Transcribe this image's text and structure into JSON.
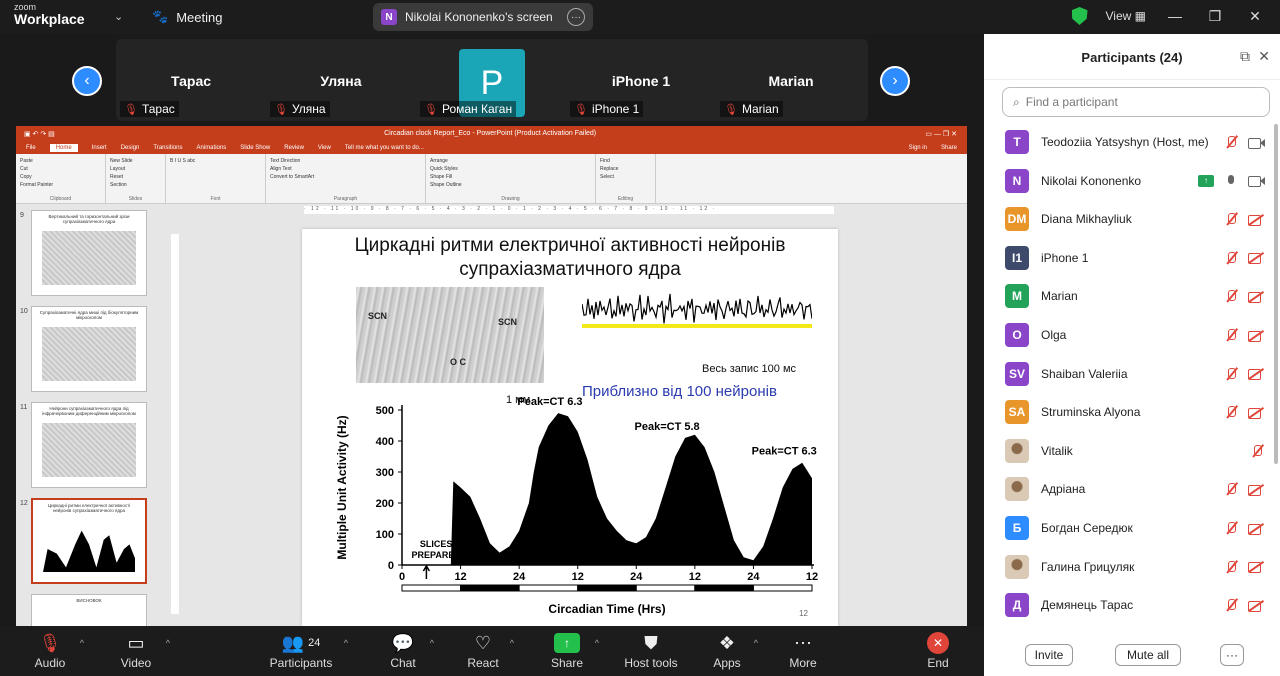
{
  "titlebar": {
    "logo_line1": "zoom",
    "logo_line2": "Workplace",
    "meeting_label": "Meeting",
    "screen_badge": "N",
    "screen_label": "Nikolai Kononenko's screen",
    "view_label": "View"
  },
  "strip": {
    "tiles": [
      {
        "name": "Тарас",
        "label": "Тарас"
      },
      {
        "name": "Уляна",
        "label": "Уляна"
      },
      {
        "name": "P",
        "label": "Роман Каган"
      },
      {
        "name": "iPhone 1",
        "label": "iPhone 1"
      },
      {
        "name": "Marian",
        "label": "Marian"
      }
    ]
  },
  "powerpoint": {
    "window_title": "Circadian clock Report_Eco - PowerPoint (Product Activation Failed)",
    "tabs": [
      "File",
      "Home",
      "Insert",
      "Design",
      "Transitions",
      "Animations",
      "Slide Show",
      "Review",
      "View",
      "Tell me what you want to do..."
    ],
    "ribbon_groups": [
      "Clipboard",
      "Slides",
      "Font",
      "Paragraph",
      "Drawing",
      "Editing"
    ],
    "ribbon_items": {
      "clipboard": [
        "Paste",
        "Cut",
        "Copy",
        "Format Painter"
      ],
      "slides": [
        "New Slide",
        "Layout",
        "Reset",
        "Section"
      ],
      "paragraph": [
        "Text Direction",
        "Align Text",
        "Convert to SmartArt"
      ],
      "drawing": [
        "Arrange",
        "Quick Styles",
        "Shape Fill",
        "Shape Outline",
        "Shape Effects"
      ],
      "editing": [
        "Find",
        "Replace",
        "Select"
      ]
    },
    "signin": "Sign in",
    "share": "Share",
    "ruler": "· 12 · 11 · 10 · 9 · 8 · 7 · 6 · 5 · 4 · 3 · 2 · 1 · 0 · 1 · 2 · 3 · 4 · 5 · 6 · 7 · 8 · 9 · 10 · 11 · 12 ·",
    "thumbnails": [
      {
        "num": "9",
        "title": "Вертикальний та горизонтальний зрізи супрахіазматичного ядра"
      },
      {
        "num": "10",
        "title": "Супрахіазматичні ядра миші під біокуляторним мікроскопом"
      },
      {
        "num": "11",
        "title": "Нейрони супрахіазматичного ядра під інфрачервоним диференційним мікроскопом"
      },
      {
        "num": "12",
        "title": "Циркадні ритми електричної активності нейронів супрахіазматичного ядра"
      },
      {
        "num": "",
        "title": "ВИСНОВОК"
      }
    ],
    "slide": {
      "title_line1": "Циркадні ритми електричної активності нейронів",
      "title_line2": "супрахіазматичного ядра",
      "micro_labels": [
        "SCN",
        "SCN",
        "O C"
      ],
      "scale_label": "1 мм",
      "trace_note": "Весь запис 100 мс",
      "blue_note": "Приблизно від 100 нейронів",
      "slide_number": "12"
    }
  },
  "chart_data": {
    "type": "area",
    "title": "",
    "xlabel": "Circadian Time (Hrs)",
    "ylabel": "Multiple Unit Activity (Hz)",
    "ylim": [
      0,
      500
    ],
    "yticks": [
      0,
      100,
      200,
      300,
      400,
      500
    ],
    "xtick_labels": [
      "0",
      "12",
      "24",
      "12",
      "24",
      "12",
      "24",
      "12"
    ],
    "x": [
      10,
      10.5,
      12,
      14,
      16,
      18,
      20,
      22,
      24,
      26,
      27,
      28,
      30,
      32,
      34,
      36,
      38,
      40,
      42,
      44,
      46,
      48,
      50,
      52,
      54,
      56,
      58,
      60,
      62,
      64,
      66,
      68,
      70,
      72,
      74,
      76,
      78,
      80,
      82,
      84
    ],
    "series": [
      {
        "values": [
          0,
          270,
          250,
          220,
          150,
          70,
          40,
          60,
          110,
          200,
          300,
          380,
          450,
          490,
          480,
          430,
          340,
          220,
          150,
          110,
          80,
          70,
          90,
          150,
          250,
          350,
          410,
          420,
          380,
          300,
          190,
          80,
          25,
          15,
          60,
          150,
          250,
          310,
          330,
          280
        ]
      }
    ],
    "annotations": [
      {
        "text": "Peak=CT  6.3",
        "x": 34
      },
      {
        "text": "Peak=CT  5.8",
        "x": 58
      },
      {
        "text": "Peak=CT  6.3",
        "x": 82
      },
      {
        "text": "SLICES PREPARED",
        "x": 7
      }
    ]
  },
  "participants": {
    "title": "Participants (24)",
    "search_placeholder": "Find a participant",
    "list": [
      {
        "initials": "T",
        "color": "#8a45c8",
        "name": "Teodoziia Yatsyshyn (Host, me)",
        "mic": "off",
        "cam": "on"
      },
      {
        "initials": "N",
        "color": "#8a45c8",
        "name": "Nikolai Kononenko",
        "mic": "on",
        "cam": "on",
        "sharing": true
      },
      {
        "initials": "DM",
        "color": "#e8962a",
        "name": "Diana Mikhayliuk",
        "mic": "off",
        "cam": "off"
      },
      {
        "initials": "I1",
        "color": "#3d4a6b",
        "name": "iPhone 1",
        "mic": "off",
        "cam": "off"
      },
      {
        "initials": "M",
        "color": "#23a35a",
        "name": "Marian",
        "mic": "off",
        "cam": "off"
      },
      {
        "initials": "O",
        "color": "#8a45c8",
        "name": "Olga",
        "mic": "off",
        "cam": "off"
      },
      {
        "initials": "SV",
        "color": "#8a45c8",
        "name": "Shaiban Valeriia",
        "mic": "off",
        "cam": "off"
      },
      {
        "initials": "SA",
        "color": "#e8962a",
        "name": "Struminska Alyona",
        "mic": "off",
        "cam": "off"
      },
      {
        "initials": "",
        "color": "#ffffff",
        "name": "Vitalik",
        "mic": "off",
        "cam": "none",
        "photo": true
      },
      {
        "initials": "",
        "color": "#ffffff",
        "name": "Адріана",
        "mic": "off",
        "cam": "off",
        "photo": true
      },
      {
        "initials": "Б",
        "color": "#2d8cff",
        "name": "Богдан Середюк",
        "mic": "off",
        "cam": "off"
      },
      {
        "initials": "",
        "color": "#ffffff",
        "name": "Галина Грицуляк",
        "mic": "off",
        "cam": "off",
        "photo": true
      },
      {
        "initials": "Д",
        "color": "#8a45c8",
        "name": "Демянець Тарас",
        "mic": "off",
        "cam": "off"
      }
    ],
    "invite_label": "Invite",
    "mute_all_label": "Mute all",
    "more_label": "···"
  },
  "toolbar": {
    "audio": "Audio",
    "video": "Video",
    "participants_count": "24",
    "participants": "Participants",
    "chat": "Chat",
    "react": "React",
    "share": "Share",
    "host_tools": "Host tools",
    "apps": "Apps",
    "more": "More",
    "end": "End"
  }
}
